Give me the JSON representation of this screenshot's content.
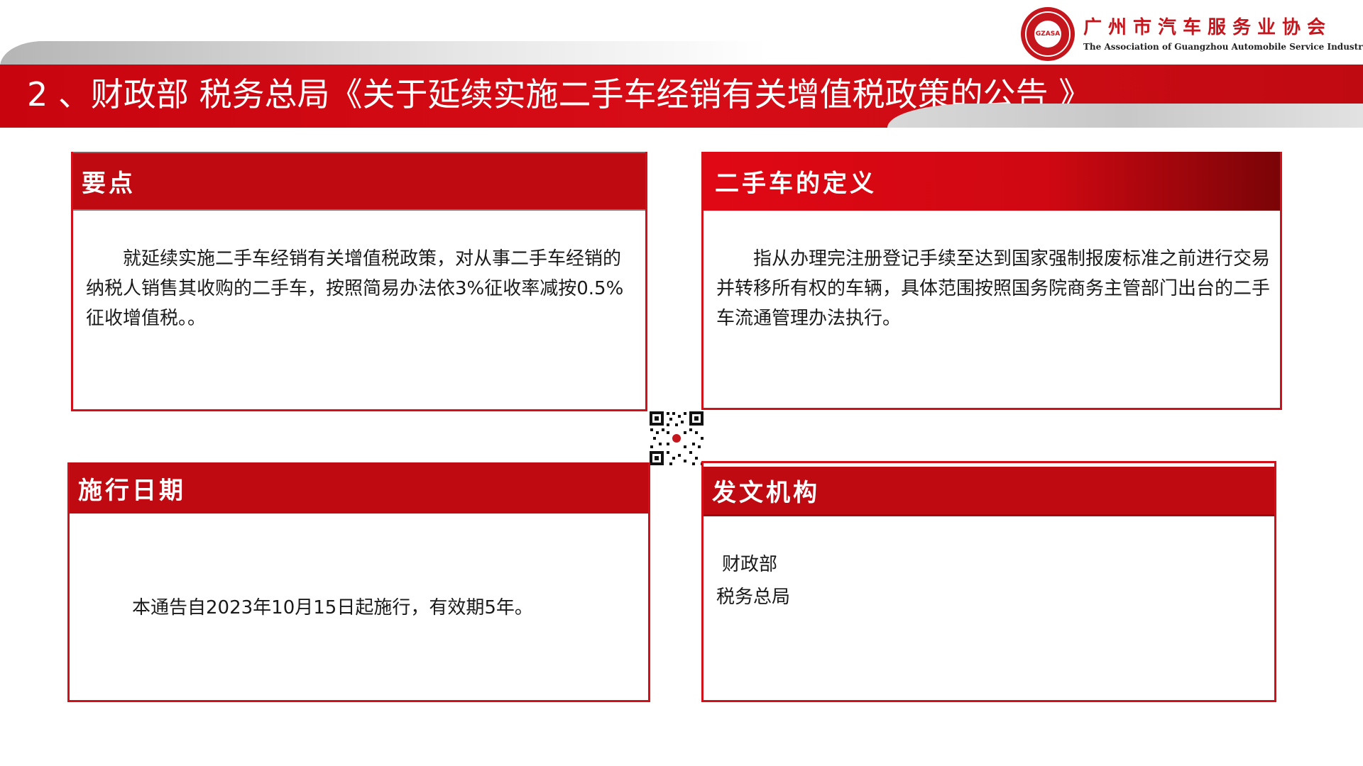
{
  "header": {
    "title": "2 、财政部 税务总局《关于延续实施二手车经销有关增值税政策的公告 》",
    "logo_cn": "广州市汽车服务业协会",
    "logo_en": "The Association of Guangzhou Automobile Service Industry",
    "logo_seal_text": "GZASA",
    "brand_color": "#c4161c"
  },
  "cards": {
    "yaodian": {
      "heading": "要点",
      "body": "就延续实施二手车经销有关增值税政策，对从事二手车经销的纳税人销售其收购的二手车，按照简易办法依3%征收率减按0.5%征收增值税。。"
    },
    "dingyi": {
      "heading": "二手车的定义",
      "body": "指从办理完注册登记手续至达到国家强制报废标准之前进行交易并转移所有权的车辆，具体范围按照国务院商务主管部门出台的二手车流通管理办法执行。"
    },
    "shixing": {
      "heading": "施行日期",
      "body": "本通告自2023年10月15日起施行，有效期5年。"
    },
    "fawen": {
      "heading": "发文机构",
      "line1": "财政部",
      "line2": "税务总局"
    }
  },
  "qr_icon": "qr-code-icon"
}
